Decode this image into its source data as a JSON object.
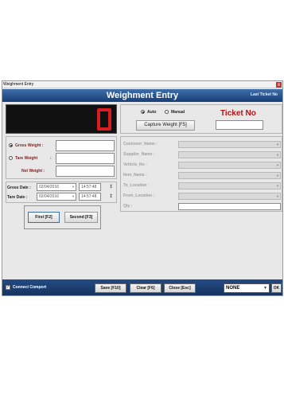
{
  "window": {
    "title": "Weighment Entry",
    "close_glyph": "x"
  },
  "header": {
    "title": "Weighment Entry",
    "last_ticket": "Last Ticket No"
  },
  "display": {
    "value": "0",
    "color": "#d81e1e"
  },
  "mode": {
    "auto_label": "Auto",
    "manual_label": "Manual",
    "selected": "Auto"
  },
  "capture_button": "Capture Weight [F5]",
  "ticket": {
    "label": "Ticket No",
    "value": ""
  },
  "weights": {
    "gross_label": "Gross Weight :",
    "tare_label": "Tare Weight",
    "tare_colon": ":",
    "net_label": "Net Weight :",
    "gross_value": "",
    "tare_value": "",
    "net_value": ""
  },
  "dates": {
    "gross_label": "Gross Date :",
    "tare_label": "Tare Date :",
    "gross_date": "02/04/2016",
    "tare_date": "02/04/2016",
    "gross_time": "14:57:48",
    "tare_time": "14:57:48",
    "spin_glyph": "↕"
  },
  "stage_buttons": {
    "first": "First [F2]",
    "second": "Second [F3]"
  },
  "details": [
    {
      "name": "customer",
      "label": "Customer_Name :"
    },
    {
      "name": "supplier",
      "label": "Supplier_Name :"
    },
    {
      "name": "vehicle",
      "label": "Vehicle_No :"
    },
    {
      "name": "item",
      "label": "Item_Name :"
    },
    {
      "name": "to-location",
      "label": "To_Location :"
    },
    {
      "name": "from-location",
      "label": "From_Location :"
    },
    {
      "name": "qty",
      "label": "Qty :"
    }
  ],
  "footer": {
    "connect_label": "Connect Comport",
    "save": "Save [F10]",
    "clear": "Clear [F6]",
    "close": "Close [Esc]",
    "port_value": "NONE",
    "ok": "OK"
  },
  "colors": {
    "header": "#1f4a85",
    "label_red": "#8b1a1a",
    "ticket_red": "#b01515"
  }
}
